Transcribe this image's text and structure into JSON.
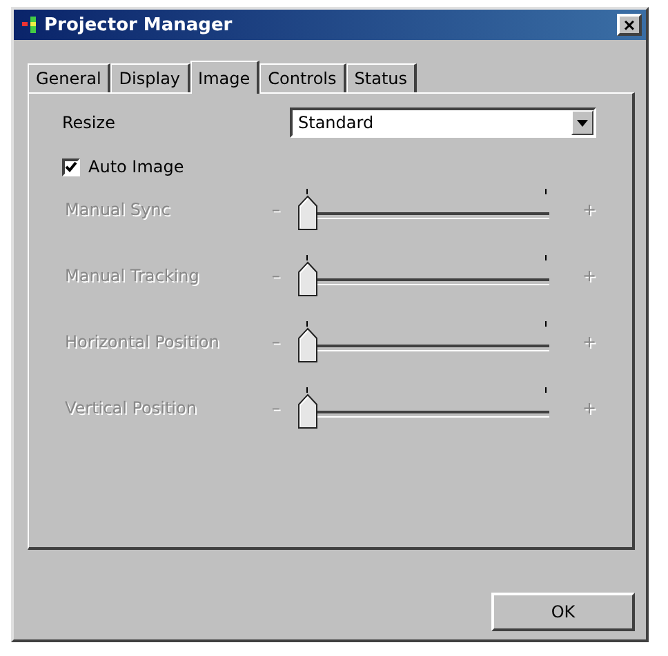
{
  "window": {
    "title": "Projector Manager",
    "close": "×"
  },
  "tabs": [
    {
      "label": "General",
      "selected": false
    },
    {
      "label": "Display",
      "selected": false
    },
    {
      "label": "Image",
      "selected": true
    },
    {
      "label": "Controls",
      "selected": false
    },
    {
      "label": "Status",
      "selected": false
    }
  ],
  "resize": {
    "label": "Resize",
    "value": "Standard"
  },
  "auto_image": {
    "label": "Auto Image",
    "checked": true
  },
  "sliders": [
    {
      "label": "Manual Sync",
      "disabled": true,
      "level": 0,
      "minus": "–",
      "plus": "+"
    },
    {
      "label": "Manual Tracking",
      "disabled": true,
      "level": 0,
      "minus": "–",
      "plus": "+"
    },
    {
      "label": "Horizontal Position",
      "disabled": true,
      "level": 0,
      "minus": "–",
      "plus": "+"
    },
    {
      "label": "Vertical Position",
      "disabled": true,
      "level": 0,
      "minus": "–",
      "plus": "+"
    }
  ],
  "buttons": [
    "OK"
  ]
}
